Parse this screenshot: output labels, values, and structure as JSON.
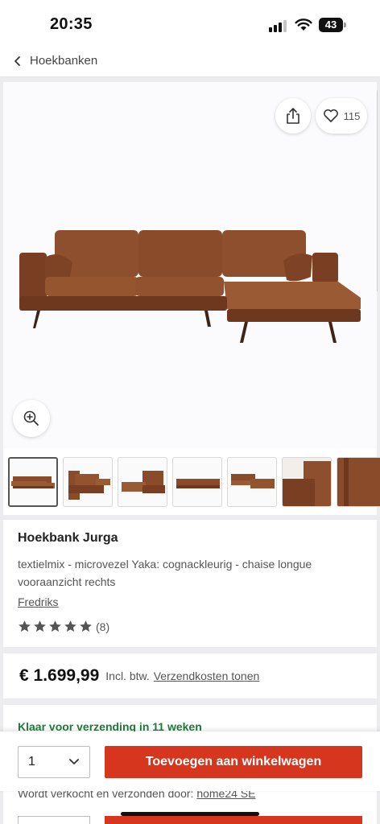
{
  "status_bar": {
    "time": "20:35",
    "battery": "43"
  },
  "breadcrumb": {
    "label": "Hoekbanken"
  },
  "gallery": {
    "likes": "115",
    "thumbnail_count": 7,
    "active_thumbnail": 1
  },
  "product": {
    "title": "Hoekbank Jurga",
    "subtitle": "textielmix - microvezel Yaka: cognackleurig - chaise longue vooraanzicht rechts",
    "brand": "Fredriks",
    "rating": 5,
    "review_count": "(8)"
  },
  "price": {
    "amount": "€ 1.699,99",
    "incl": "Incl. btw.",
    "shipping_link": "Verzendkosten tonen"
  },
  "availability": {
    "status": "Klaar voor verzending in 11 weken",
    "seller_prefix": "Wordt verkocht en verzonden door:",
    "seller": "home24 SE"
  },
  "cart": {
    "quantity": "1",
    "add_label": "Toevoegen aan winkelwagen"
  },
  "colors": {
    "accent": "#d7361e",
    "availability_green": "#1f7c3a",
    "sofa": "#8a4a2c"
  }
}
